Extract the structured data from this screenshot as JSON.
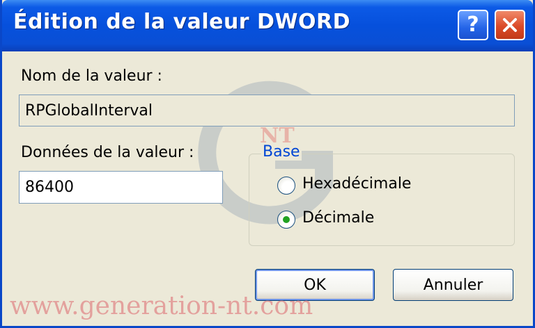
{
  "window": {
    "title": "Édition de la valeur DWORD",
    "help_glyph": "?",
    "colors": {
      "titlebar": "#0a50dc",
      "close": "#db4a28",
      "face": "#ece9d8",
      "accent": "#0046d5"
    }
  },
  "form": {
    "name_label": "Nom de la valeur :",
    "name_value": "RPGlobalInterval",
    "data_label": "Données de la valeur :",
    "data_value": "86400"
  },
  "base": {
    "title": "Base",
    "options": [
      {
        "label": "Hexadécimale",
        "selected": false
      },
      {
        "label": "Décimale",
        "selected": true
      }
    ]
  },
  "buttons": {
    "ok": "OK",
    "cancel": "Annuler"
  },
  "watermark": {
    "text": "www.generation-nt.com",
    "logo_text": "NT"
  }
}
